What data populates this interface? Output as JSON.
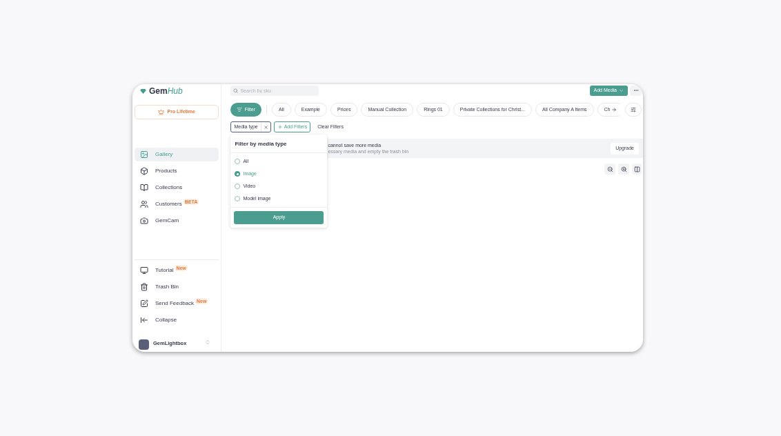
{
  "logo": {
    "prefix": "Gem",
    "suffix": "Hub"
  },
  "plan_button": {
    "label": "Pro Lifetime"
  },
  "nav": [
    {
      "label": "Gallery",
      "selected": true
    },
    {
      "label": "Products",
      "selected": false
    },
    {
      "label": "Collections",
      "selected": false
    },
    {
      "label": "Customers",
      "selected": false,
      "badge": "BETA"
    },
    {
      "label": "GemCam",
      "selected": false
    }
  ],
  "bottom_nav": [
    {
      "label": "Tutorial",
      "badge": "New"
    },
    {
      "label": "Trash Bin"
    },
    {
      "label": "Send Feedback",
      "badge": "New"
    },
    {
      "label": "Collapse"
    }
  ],
  "workspace": {
    "name": "GemLightbox"
  },
  "search": {
    "placeholder": "Search by sku"
  },
  "add_media": {
    "label": "Add Media"
  },
  "filter_button": {
    "label": "Filter"
  },
  "chips": [
    {
      "label": "All"
    },
    {
      "label": "Example"
    },
    {
      "label": "Prices"
    },
    {
      "label": "Manual Collection"
    },
    {
      "label": "Rings 01"
    },
    {
      "label": "Private Collections for Christ..."
    },
    {
      "label": "All Company A Items"
    },
    {
      "label": "Ch"
    }
  ],
  "active_filter": {
    "label": "Media type"
  },
  "add_filters": {
    "label": "Add Filters"
  },
  "clear_filters": {
    "label": "Clear Filters"
  },
  "banner": {
    "title": "cannot save more media",
    "subtitle": "essary media and empty the trash bin",
    "button": "Upgrade"
  },
  "dropdown": {
    "title": "Filter by media type",
    "options": [
      {
        "label": "All",
        "selected": false
      },
      {
        "label": "Image",
        "selected": true
      },
      {
        "label": "Video",
        "selected": false
      },
      {
        "label": "Model image",
        "selected": false
      }
    ],
    "apply": "Apply"
  }
}
